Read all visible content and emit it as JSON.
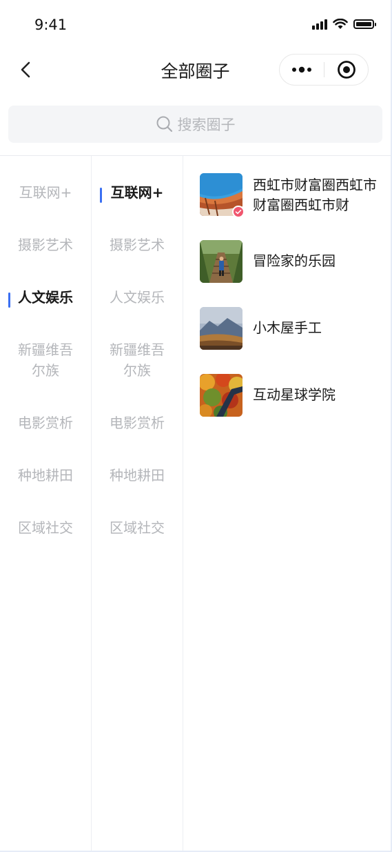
{
  "status_bar": {
    "time": "9:41"
  },
  "nav": {
    "title": "全部圈子",
    "back_icon": "chevron-left-icon",
    "more_icon": "more-dots-icon",
    "target_icon": "target-icon"
  },
  "search": {
    "placeholder": "搜索圈子",
    "icon": "search-icon"
  },
  "colors": {
    "accent": "#3a6ff2",
    "badge": "#f0566e",
    "muted_text": "#b4b6ba"
  },
  "primary_categories": [
    {
      "label": "互联网+",
      "active": false
    },
    {
      "label": "摄影艺术",
      "active": false
    },
    {
      "label": "人文娱乐",
      "active": true
    },
    {
      "label": "新疆维吾尔族",
      "active": false
    },
    {
      "label": "电影赏析",
      "active": false
    },
    {
      "label": "种地耕田",
      "active": false
    },
    {
      "label": "区域社交",
      "active": false
    }
  ],
  "secondary_categories": [
    {
      "label": "互联网+",
      "active": true
    },
    {
      "label": "摄影艺术",
      "active": false
    },
    {
      "label": "人文娱乐",
      "active": false
    },
    {
      "label": "新疆维吾尔族",
      "active": false
    },
    {
      "label": "电影赏析",
      "active": false
    },
    {
      "label": "种地耕田",
      "active": false
    },
    {
      "label": "区域社交",
      "active": false
    }
  ],
  "circles": [
    {
      "name": "西虹市财富圈西虹市财富圈西虹市财",
      "verified": true,
      "image": "architecture-photo"
    },
    {
      "name": "冒险家的乐园",
      "verified": false,
      "image": "suspension-bridge-photo"
    },
    {
      "name": "小木屋手工",
      "verified": false,
      "image": "mountain-landscape-photo"
    },
    {
      "name": "互动星球学院",
      "verified": false,
      "image": "autumn-forest-photo"
    }
  ]
}
